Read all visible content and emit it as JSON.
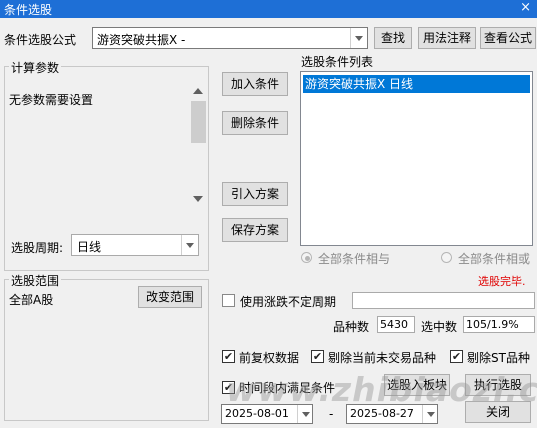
{
  "window": {
    "title": "条件选股",
    "close_symbol": "×"
  },
  "formula": {
    "label": "条件选股公式",
    "value": "游资突破共振X  -"
  },
  "top_buttons": {
    "find": "查找",
    "usage": "用法注释",
    "view": "查看公式"
  },
  "params": {
    "legend": "计算参数",
    "message": "无参数需要设置"
  },
  "period": {
    "label": "选股周期:",
    "value": "日线"
  },
  "action_buttons": {
    "add": "加入条件",
    "delete": "删除条件",
    "import_plan": "引入方案",
    "save_plan": "保存方案"
  },
  "condition_list": {
    "title": "选股条件列表",
    "items": [
      "游资突破共振X  日线"
    ]
  },
  "logic": {
    "and_label": "全部条件相与",
    "or_label": "全部条件相或"
  },
  "status": {
    "text": "选股完毕.",
    "color": "#e00000"
  },
  "range": {
    "legend": "选股范围",
    "value": "全部A股",
    "change_button": "改变范围"
  },
  "options": {
    "limit_period": "使用涨跌不定周期",
    "pre_adjust": "前复权数据",
    "exclude_untraded": "剔除当前未交易品种",
    "exclude_st": "剔除ST品种",
    "time_range": "时间段内满足条件"
  },
  "stats": {
    "count_label": "品种数",
    "count_value": "5430",
    "selected_label": "选中数",
    "selected_value": "105/1.9%"
  },
  "bottom_buttons": {
    "to_board": "选股入板块",
    "execute": "执行选股",
    "close": "关闭"
  },
  "dates": {
    "start": "2025-08-01",
    "separator": "-",
    "end": "2025-08-27"
  },
  "watermark": "www.zhibiaozi.com",
  "checkmark": "✔",
  "colors": {
    "titlebar": "#1e6fd6",
    "selection": "#0078d7"
  }
}
